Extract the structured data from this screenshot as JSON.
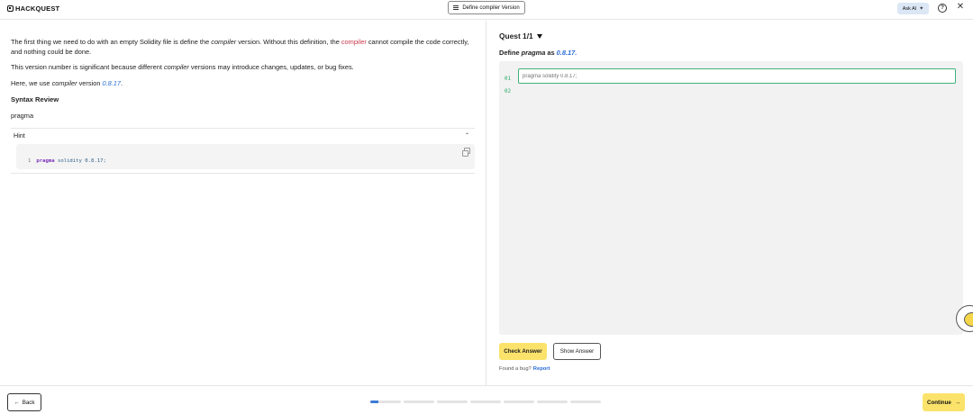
{
  "header": {
    "logo_text": "HACKQUEST",
    "lesson_title": "Define compiler Version",
    "ask_ai_label": "Ask AI",
    "help_icon": "question-circle-icon",
    "close_icon": "close-icon"
  },
  "lesson": {
    "p1": {
      "t1": "The first thing we need to do with an empty Solidity file is define the ",
      "e1": "compiler",
      "t2": " version. Without this definition, the ",
      "e2": "compiler",
      "t3": " cannot compile the code correctly, and nothing could be done."
    },
    "p2": {
      "t1": "This version number is significant because different ",
      "e1": "compiler",
      "t2": " versions may introduce changes, updates, or bug fixes."
    },
    "p3": {
      "t1": "Here, we use ",
      "e1": "compiler",
      "t2": " version ",
      "v": "0.8.17",
      "t3": "."
    },
    "syntax_title": "Syntax Review",
    "syntax_text": "pragma",
    "hint_label": "Hint",
    "hint_code": {
      "line_no": "1",
      "keyword": "pragma",
      "rest": " solidity 0.8.17;"
    }
  },
  "quest": {
    "title": "Quest 1/1",
    "desc_prefix": "Define ",
    "desc_keyword": "pragma",
    "desc_mid": " as ",
    "desc_value": "0.8.17.",
    "line_numbers": [
      "01",
      "02"
    ],
    "input_placeholder": "pragma solidity 0.8.17;",
    "input_value": "",
    "check_label": "Check Answer",
    "show_label": "Show Answer",
    "bug_text": "Found a bug?",
    "report_label": "Report"
  },
  "footer": {
    "back_label": "Back",
    "continue_label": "Continue",
    "progress_segments": [
      0.25,
      0,
      0,
      0,
      0,
      0,
      0
    ]
  },
  "colors": {
    "accent_yellow": "#fbe36b",
    "accent_blue": "#2a6cd6",
    "accent_red": "#c8384a",
    "editor_green": "#3fb27a"
  }
}
